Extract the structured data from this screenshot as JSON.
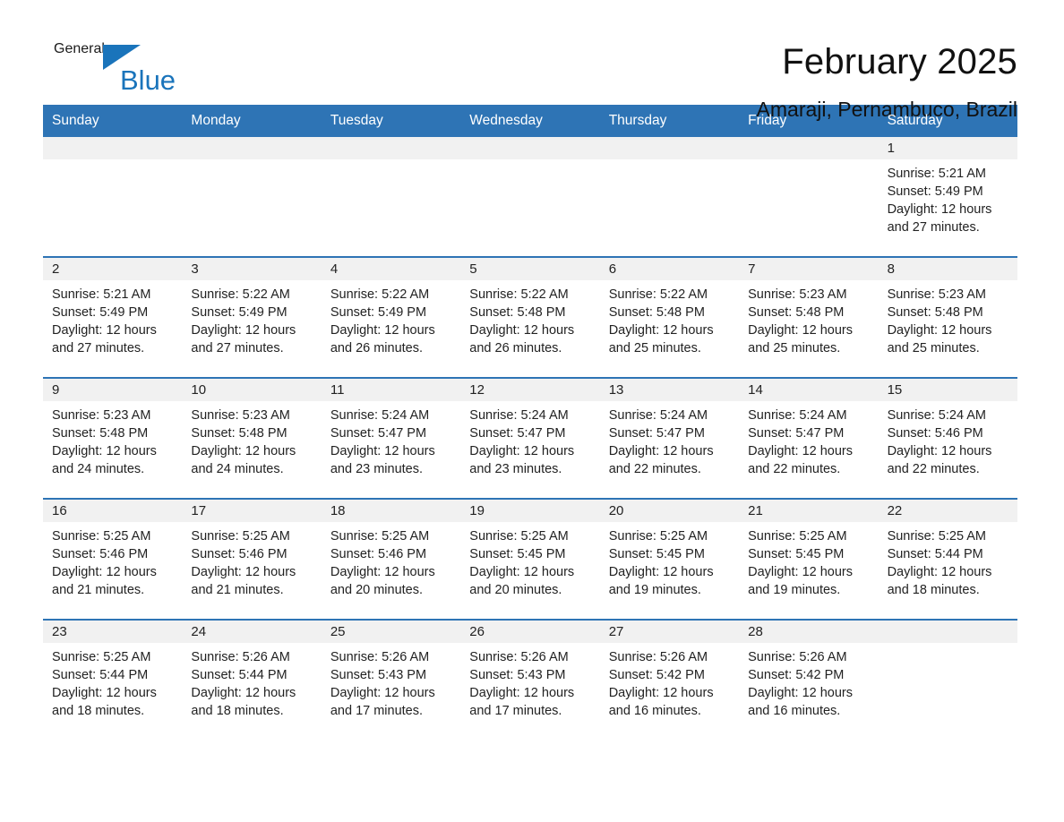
{
  "brand": {
    "name_part1": "General",
    "name_part2": "Blue",
    "triangle_color": "#1a74bb"
  },
  "header": {
    "title": "February 2025",
    "subtitle": "Amaraji, Pernambuco, Brazil"
  },
  "theme": {
    "header_blue": "#2e74b5",
    "day_band_gray": "#f1f1f1",
    "text": "#222222"
  },
  "weekdays": [
    "Sunday",
    "Monday",
    "Tuesday",
    "Wednesday",
    "Thursday",
    "Friday",
    "Saturday"
  ],
  "weeks": [
    [
      {
        "day": "",
        "sunrise": "",
        "sunset": "",
        "daylight": "",
        "empty": true
      },
      {
        "day": "",
        "sunrise": "",
        "sunset": "",
        "daylight": "",
        "empty": true
      },
      {
        "day": "",
        "sunrise": "",
        "sunset": "",
        "daylight": "",
        "empty": true
      },
      {
        "day": "",
        "sunrise": "",
        "sunset": "",
        "daylight": "",
        "empty": true
      },
      {
        "day": "",
        "sunrise": "",
        "sunset": "",
        "daylight": "",
        "empty": true
      },
      {
        "day": "",
        "sunrise": "",
        "sunset": "",
        "daylight": "",
        "empty": true
      },
      {
        "day": "1",
        "sunrise": "Sunrise: 5:21 AM",
        "sunset": "Sunset: 5:49 PM",
        "daylight": "Daylight: 12 hours and 27 minutes."
      }
    ],
    [
      {
        "day": "2",
        "sunrise": "Sunrise: 5:21 AM",
        "sunset": "Sunset: 5:49 PM",
        "daylight": "Daylight: 12 hours and 27 minutes."
      },
      {
        "day": "3",
        "sunrise": "Sunrise: 5:22 AM",
        "sunset": "Sunset: 5:49 PM",
        "daylight": "Daylight: 12 hours and 27 minutes."
      },
      {
        "day": "4",
        "sunrise": "Sunrise: 5:22 AM",
        "sunset": "Sunset: 5:49 PM",
        "daylight": "Daylight: 12 hours and 26 minutes."
      },
      {
        "day": "5",
        "sunrise": "Sunrise: 5:22 AM",
        "sunset": "Sunset: 5:48 PM",
        "daylight": "Daylight: 12 hours and 26 minutes."
      },
      {
        "day": "6",
        "sunrise": "Sunrise: 5:22 AM",
        "sunset": "Sunset: 5:48 PM",
        "daylight": "Daylight: 12 hours and 25 minutes."
      },
      {
        "day": "7",
        "sunrise": "Sunrise: 5:23 AM",
        "sunset": "Sunset: 5:48 PM",
        "daylight": "Daylight: 12 hours and 25 minutes."
      },
      {
        "day": "8",
        "sunrise": "Sunrise: 5:23 AM",
        "sunset": "Sunset: 5:48 PM",
        "daylight": "Daylight: 12 hours and 25 minutes."
      }
    ],
    [
      {
        "day": "9",
        "sunrise": "Sunrise: 5:23 AM",
        "sunset": "Sunset: 5:48 PM",
        "daylight": "Daylight: 12 hours and 24 minutes."
      },
      {
        "day": "10",
        "sunrise": "Sunrise: 5:23 AM",
        "sunset": "Sunset: 5:48 PM",
        "daylight": "Daylight: 12 hours and 24 minutes."
      },
      {
        "day": "11",
        "sunrise": "Sunrise: 5:24 AM",
        "sunset": "Sunset: 5:47 PM",
        "daylight": "Daylight: 12 hours and 23 minutes."
      },
      {
        "day": "12",
        "sunrise": "Sunrise: 5:24 AM",
        "sunset": "Sunset: 5:47 PM",
        "daylight": "Daylight: 12 hours and 23 minutes."
      },
      {
        "day": "13",
        "sunrise": "Sunrise: 5:24 AM",
        "sunset": "Sunset: 5:47 PM",
        "daylight": "Daylight: 12 hours and 22 minutes."
      },
      {
        "day": "14",
        "sunrise": "Sunrise: 5:24 AM",
        "sunset": "Sunset: 5:47 PM",
        "daylight": "Daylight: 12 hours and 22 minutes."
      },
      {
        "day": "15",
        "sunrise": "Sunrise: 5:24 AM",
        "sunset": "Sunset: 5:46 PM",
        "daylight": "Daylight: 12 hours and 22 minutes."
      }
    ],
    [
      {
        "day": "16",
        "sunrise": "Sunrise: 5:25 AM",
        "sunset": "Sunset: 5:46 PM",
        "daylight": "Daylight: 12 hours and 21 minutes."
      },
      {
        "day": "17",
        "sunrise": "Sunrise: 5:25 AM",
        "sunset": "Sunset: 5:46 PM",
        "daylight": "Daylight: 12 hours and 21 minutes."
      },
      {
        "day": "18",
        "sunrise": "Sunrise: 5:25 AM",
        "sunset": "Sunset: 5:46 PM",
        "daylight": "Daylight: 12 hours and 20 minutes."
      },
      {
        "day": "19",
        "sunrise": "Sunrise: 5:25 AM",
        "sunset": "Sunset: 5:45 PM",
        "daylight": "Daylight: 12 hours and 20 minutes."
      },
      {
        "day": "20",
        "sunrise": "Sunrise: 5:25 AM",
        "sunset": "Sunset: 5:45 PM",
        "daylight": "Daylight: 12 hours and 19 minutes."
      },
      {
        "day": "21",
        "sunrise": "Sunrise: 5:25 AM",
        "sunset": "Sunset: 5:45 PM",
        "daylight": "Daylight: 12 hours and 19 minutes."
      },
      {
        "day": "22",
        "sunrise": "Sunrise: 5:25 AM",
        "sunset": "Sunset: 5:44 PM",
        "daylight": "Daylight: 12 hours and 18 minutes."
      }
    ],
    [
      {
        "day": "23",
        "sunrise": "Sunrise: 5:25 AM",
        "sunset": "Sunset: 5:44 PM",
        "daylight": "Daylight: 12 hours and 18 minutes."
      },
      {
        "day": "24",
        "sunrise": "Sunrise: 5:26 AM",
        "sunset": "Sunset: 5:44 PM",
        "daylight": "Daylight: 12 hours and 18 minutes."
      },
      {
        "day": "25",
        "sunrise": "Sunrise: 5:26 AM",
        "sunset": "Sunset: 5:43 PM",
        "daylight": "Daylight: 12 hours and 17 minutes."
      },
      {
        "day": "26",
        "sunrise": "Sunrise: 5:26 AM",
        "sunset": "Sunset: 5:43 PM",
        "daylight": "Daylight: 12 hours and 17 minutes."
      },
      {
        "day": "27",
        "sunrise": "Sunrise: 5:26 AM",
        "sunset": "Sunset: 5:42 PM",
        "daylight": "Daylight: 12 hours and 16 minutes."
      },
      {
        "day": "28",
        "sunrise": "Sunrise: 5:26 AM",
        "sunset": "Sunset: 5:42 PM",
        "daylight": "Daylight: 12 hours and 16 minutes."
      },
      {
        "day": "",
        "sunrise": "",
        "sunset": "",
        "daylight": "",
        "empty": true
      }
    ]
  ]
}
